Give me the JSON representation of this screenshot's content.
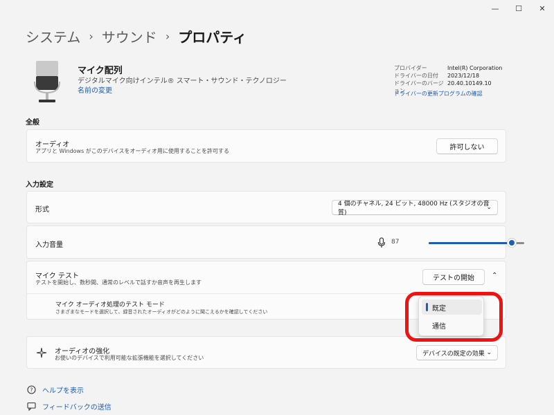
{
  "window": {
    "minimize": "—",
    "maximize": "☐",
    "close": "✕"
  },
  "breadcrumb": {
    "items": [
      "システム",
      "サウンド"
    ],
    "separator": "›",
    "current": "プロパティ"
  },
  "device": {
    "name": "マイク配列",
    "description": "デジタルマイク向けインテル® スマート・サウンド・テクノロジー",
    "rename_link": "名前の変更",
    "icon": "microphone-device-icon"
  },
  "driver_info": {
    "rows": [
      {
        "label": "プロバイダー",
        "value": "Intel(R) Corporation"
      },
      {
        "label": "ドライバーの日付",
        "value": "2023/12/18"
      },
      {
        "label": "ドライバーのバージョン",
        "value": "20.40.10149.10"
      }
    ],
    "update_link": "ドライバーの更新プログラムの確認"
  },
  "general": {
    "title": "全般",
    "audio": {
      "title": "オーディオ",
      "subtitle": "アプリと Windows がこのデバイスをオーディオ用に使用することを許可する",
      "button": "許可しない"
    }
  },
  "input_settings": {
    "title": "入力設定",
    "format": {
      "title": "形式",
      "value": "4 個のチャネル, 24 ビット, 48000 Hz (スタジオの音質)"
    },
    "volume": {
      "title": "入力音量",
      "value": "87",
      "level_percent": 87
    },
    "mic_test": {
      "title": "マイク テスト",
      "subtitle": "テストを開始し、数秒間、通常のレベルで話すか音声を再生します",
      "button": "テストの開始",
      "mode": {
        "title": "マイク オーディオ処理のテスト モード",
        "subtitle": "さまざまなモードを選択して、録音されたオーディオがどのように聞こえるかを確認してください",
        "options": [
          "既定",
          "通信"
        ],
        "selected": "既定"
      }
    },
    "enhance": {
      "title": "オーディオの強化",
      "subtitle": "お使いのデバイスで利用可能な拡張機能を選択してください",
      "value": "デバイスの既定の効果",
      "icon": "sparkle-icon"
    }
  },
  "footer": {
    "help": "ヘルプを表示",
    "feedback": "フィードバックの送信"
  },
  "colors": {
    "accent": "#1d5db3",
    "highlight": "#ee1313",
    "background": "#f3f3f3"
  }
}
